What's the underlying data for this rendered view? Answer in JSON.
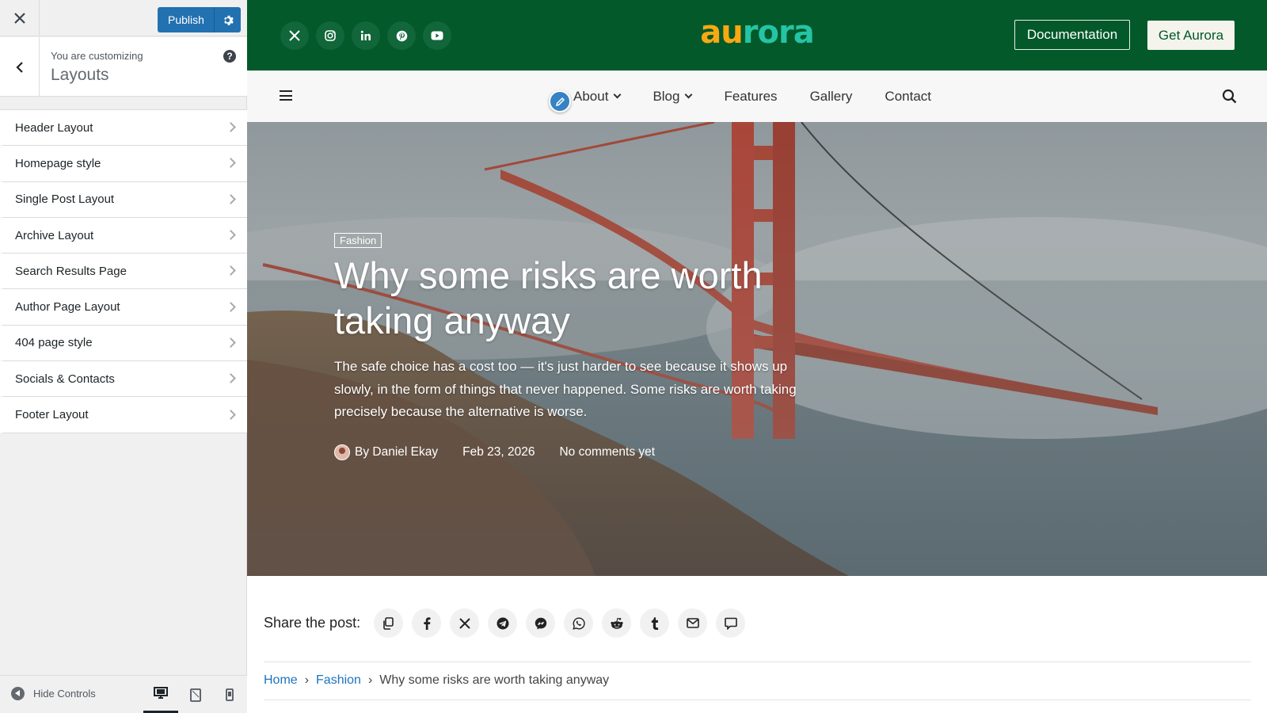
{
  "customizer": {
    "publish_label": "Publish",
    "info_small": "You are customizing",
    "info_title": "Layouts",
    "help": "?",
    "items": [
      {
        "label": "Header Layout"
      },
      {
        "label": "Homepage style"
      },
      {
        "label": "Single Post Layout"
      },
      {
        "label": "Archive Layout"
      },
      {
        "label": "Search Results Page"
      },
      {
        "label": "Author Page Layout"
      },
      {
        "label": "404 page style"
      },
      {
        "label": "Socials & Contacts"
      },
      {
        "label": "Footer Layout"
      }
    ],
    "hide_controls": "Hide Controls",
    "active_device": "desktop"
  },
  "site": {
    "logo": {
      "part1": "au",
      "part2": "rora",
      "text": "aurora"
    },
    "social_icons": [
      "x-icon",
      "instagram-icon",
      "linkedin-icon",
      "pinterest-icon",
      "youtube-icon"
    ],
    "doc_button": "Documentation",
    "get_button": "Get Aurora",
    "nav": [
      {
        "label": "About",
        "has_dropdown": true
      },
      {
        "label": "Blog",
        "has_dropdown": true
      },
      {
        "label": "Features",
        "has_dropdown": false
      },
      {
        "label": "Gallery",
        "has_dropdown": false
      },
      {
        "label": "Contact",
        "has_dropdown": false
      }
    ],
    "colors": {
      "brand_green": "#03592a",
      "logo_orange": "#f7a812",
      "logo_teal": "#24c4a4",
      "wp_blue": "#2271b1",
      "link_blue": "#1e73be"
    }
  },
  "post": {
    "category": "Fashion",
    "title": "Why some risks are worth taking anyway",
    "excerpt": "The safe choice has a cost too — it's just harder to see because it shows up slowly, in the form of things that never happened. Some risks are worth taking precisely because the alternative is worse.",
    "author": "By Daniel Ekay",
    "date": "Feb 23, 2026",
    "comments": "No comments yet"
  },
  "share": {
    "label": "Share the post:",
    "buttons": [
      "copy-link-icon",
      "facebook-icon",
      "x-icon",
      "telegram-icon",
      "messenger-icon",
      "whatsapp-icon",
      "reddit-icon",
      "tumblr-icon",
      "email-icon",
      "comment-icon"
    ]
  },
  "breadcrumb": {
    "home": "Home",
    "category": "Fashion",
    "current": "Why some risks are worth taking anyway",
    "separator": "›"
  }
}
